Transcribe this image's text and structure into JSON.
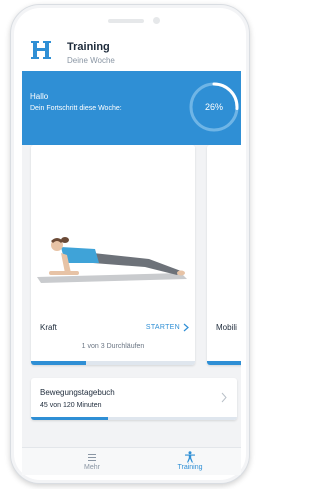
{
  "colors": {
    "accent": "#2f8fd5",
    "banner": "#2f8fd5",
    "ring_track": "#6fb5e6",
    "ring_fill": "#ffffff",
    "text_dark": "#1d2a3a",
    "text_muted": "#8a96a4"
  },
  "header": {
    "logo_icon": "h-logo-icon",
    "title": "Training",
    "subtitle": "Deine Woche"
  },
  "banner": {
    "greeting": "Hallo",
    "caption": "Dein Fortschritt diese Woche:",
    "progress_label": "26%",
    "progress_value": 0.26
  },
  "cards": [
    {
      "title": "Kraft",
      "action_label": "STARTEN",
      "progress_text": "1 von 3 Durchläufen",
      "progress_value": 0.333
    },
    {
      "title": "Mobili"
    }
  ],
  "diary": {
    "title": "Bewegungstagebuch",
    "value": "45 von 120 Minuten",
    "progress_value": 0.375
  },
  "tabs": [
    {
      "label": "Mehr",
      "icon": "menu-icon",
      "active": false
    },
    {
      "label": "Training",
      "icon": "training-person-icon",
      "active": true
    }
  ]
}
